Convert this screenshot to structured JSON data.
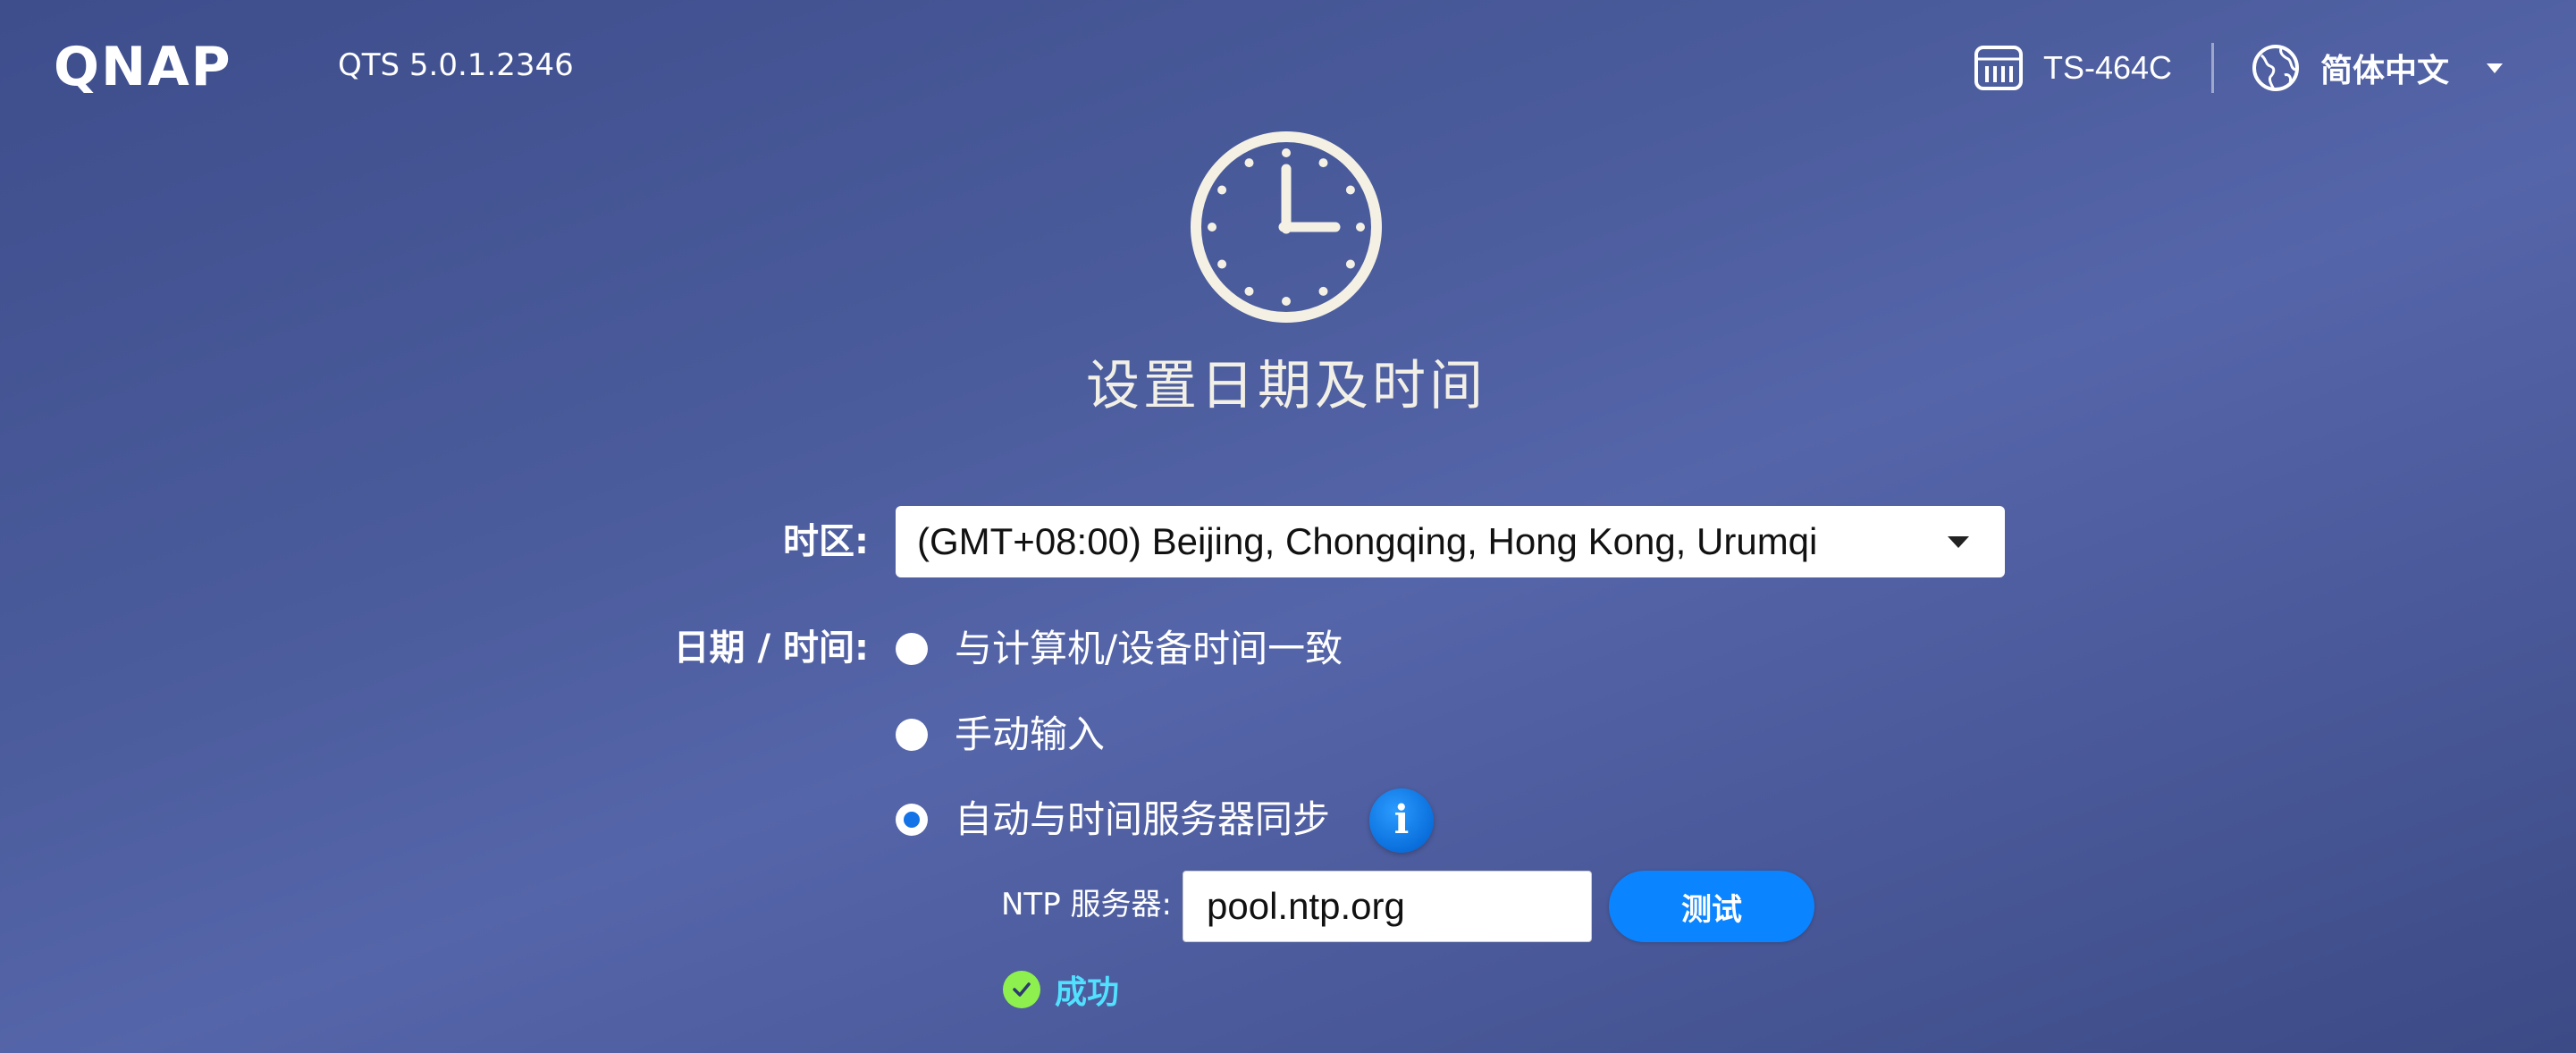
{
  "header": {
    "logo_text": "QNAP",
    "firmware": "QTS 5.0.1.2346",
    "model": "TS-464C",
    "language": "简体中文"
  },
  "hero": {
    "icon": "clock-icon",
    "title": "设置日期及时间"
  },
  "form": {
    "timezone": {
      "label": "时区:",
      "selected": "(GMT+08:00) Beijing, Chongqing, Hong Kong, Urumqi"
    },
    "datetime": {
      "label": "日期 / 时间:",
      "options": [
        {
          "label": "与计算机/设备时间一致",
          "checked": false
        },
        {
          "label": "手动输入",
          "checked": false
        },
        {
          "label": "自动与时间服务器同步",
          "checked": true
        }
      ]
    },
    "ntp": {
      "label": "NTP 服务器:",
      "value": "pool.ntp.org",
      "test_button": "测试",
      "status": "成功"
    }
  },
  "colors": {
    "accent": "#0a84ff",
    "success_check": "#8ef04f",
    "success_text": "#52e0ff"
  }
}
